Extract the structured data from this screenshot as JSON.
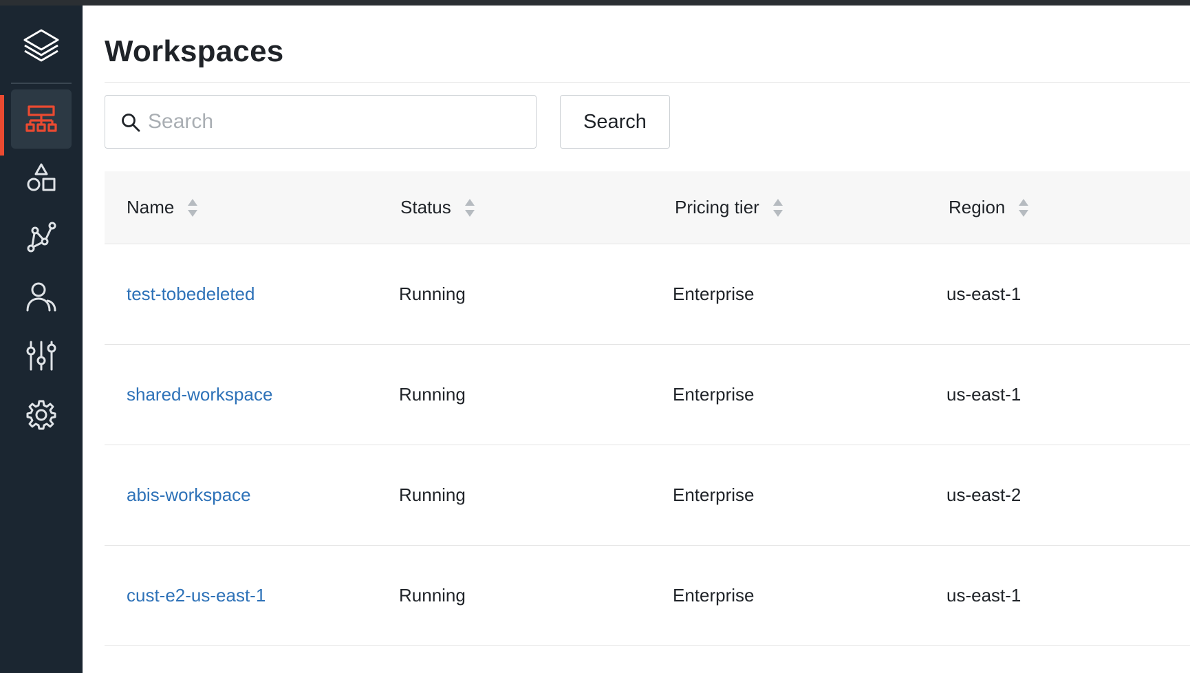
{
  "app": {
    "accent_color": "#eb4a31",
    "sidebar_color": "#1b2631",
    "link_color": "#2e72b8"
  },
  "sidebar": {
    "logo_icon": "layers-stack-icon",
    "items": [
      {
        "icon": "workspaces-hierarchy-icon",
        "active": true
      },
      {
        "icon": "shapes-icon",
        "active": false
      },
      {
        "icon": "network-graph-icon",
        "active": false
      },
      {
        "icon": "users-icon",
        "active": false
      },
      {
        "icon": "sliders-icon",
        "active": false
      },
      {
        "icon": "gear-icon",
        "active": false
      }
    ]
  },
  "page": {
    "title": "Workspaces"
  },
  "search": {
    "placeholder": "Search",
    "value": "",
    "button_label": "Search"
  },
  "table": {
    "columns": [
      "Name",
      "Status",
      "Pricing tier",
      "Region"
    ],
    "rows": [
      {
        "name": "test-tobedeleted",
        "status": "Running",
        "tier": "Enterprise",
        "region": "us-east-1"
      },
      {
        "name": "shared-workspace",
        "status": "Running",
        "tier": "Enterprise",
        "region": "us-east-1"
      },
      {
        "name": "abis-workspace",
        "status": "Running",
        "tier": "Enterprise",
        "region": "us-east-2"
      },
      {
        "name": "cust-e2-us-east-1",
        "status": "Running",
        "tier": "Enterprise",
        "region": "us-east-1"
      }
    ]
  }
}
